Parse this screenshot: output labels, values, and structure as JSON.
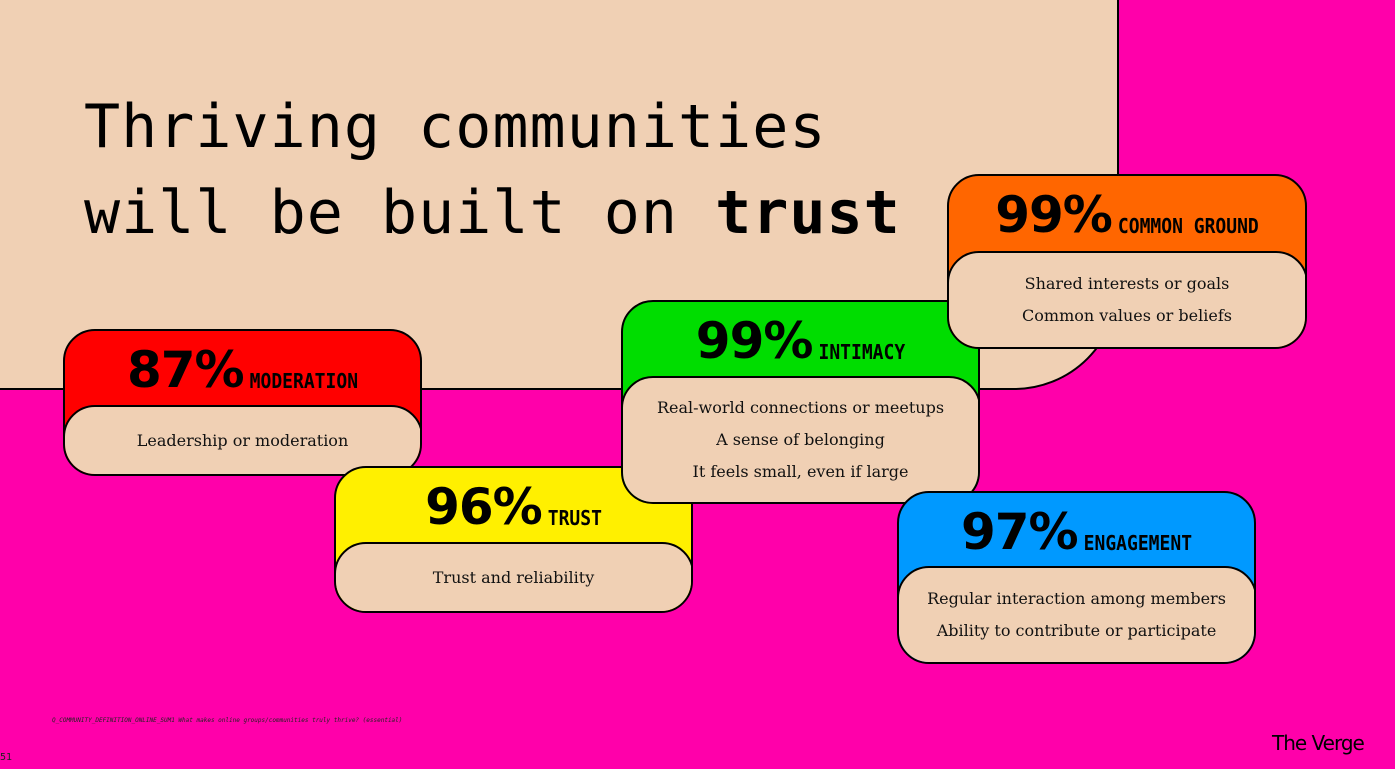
{
  "title": {
    "line1": "Thriving communities",
    "line2_prefix": "will be built on ",
    "line2_bold": "trust"
  },
  "colors": {
    "background": "#ff00aa",
    "panel": "#f0d0b4",
    "moderation": "#ff0000",
    "trust": "#fff000",
    "intimacy": "#00dd00",
    "engagement": "#0099ff",
    "common_ground": "#ff6600"
  },
  "cards": [
    {
      "id": "moderation",
      "percent": "87%",
      "label": "MODERATION",
      "items": [
        "Leadership or moderation"
      ]
    },
    {
      "id": "trust",
      "percent": "96%",
      "label": "TRUST",
      "items": [
        "Trust and reliability"
      ]
    },
    {
      "id": "intimacy",
      "percent": "99%",
      "label": "INTIMACY",
      "items": [
        "Real-world connections or meetups",
        "A sense of belonging",
        "It feels small, even if large"
      ]
    },
    {
      "id": "engagement",
      "percent": "97%",
      "label": "ENGAGEMENT",
      "items": [
        "Regular interaction among members",
        "Ability to contribute or participate"
      ]
    },
    {
      "id": "common_ground",
      "percent": "99%",
      "label": "COMMON GROUND",
      "items": [
        "Shared interests or goals",
        "Common values or beliefs"
      ]
    }
  ],
  "footnote": "Q_COMMUNITY_DEFINITION_ONLINE_SUM1 What makes online groups/communities truly thrive? (essential)",
  "page_number": "51",
  "logo": "The Verge"
}
